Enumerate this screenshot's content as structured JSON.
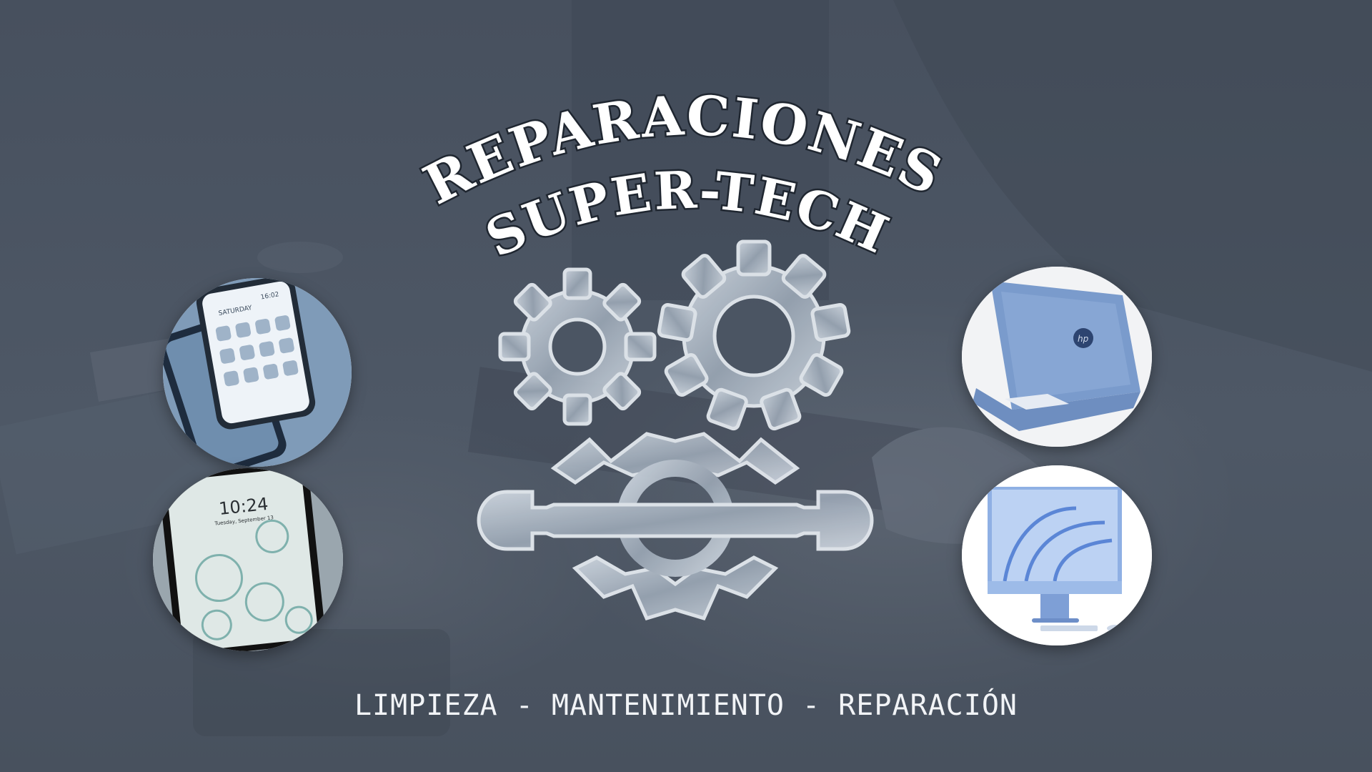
{
  "brand": {
    "title_line1": "REPARACIONES",
    "title_line2": "SUPER-TECH",
    "tagline": "LIMPIEZA - MANTENIMIENTO - REPARACIÓN",
    "logo_icon": "gears-and-wrench-icon"
  },
  "device_images": [
    {
      "name": "smartphone",
      "icon": "smartphone-icon",
      "screen_time": "16:02",
      "screen_day": "SATURDAY"
    },
    {
      "name": "tablet",
      "icon": "tablet-icon",
      "screen_time": "10:24",
      "screen_date": "Tuesday, September 13"
    },
    {
      "name": "laptop",
      "icon": "laptop-icon",
      "brand_mark": "hp"
    },
    {
      "name": "all-in-one desktop",
      "icon": "desktop-computer-icon"
    }
  ],
  "colors": {
    "background_overlay": "#4b5563",
    "title_fill": "#ffffff",
    "title_outline": "#1f2630",
    "title_shade": "#6b7787",
    "gear_fill": "#b7c2cf",
    "tagline": "#f2f4f7"
  }
}
